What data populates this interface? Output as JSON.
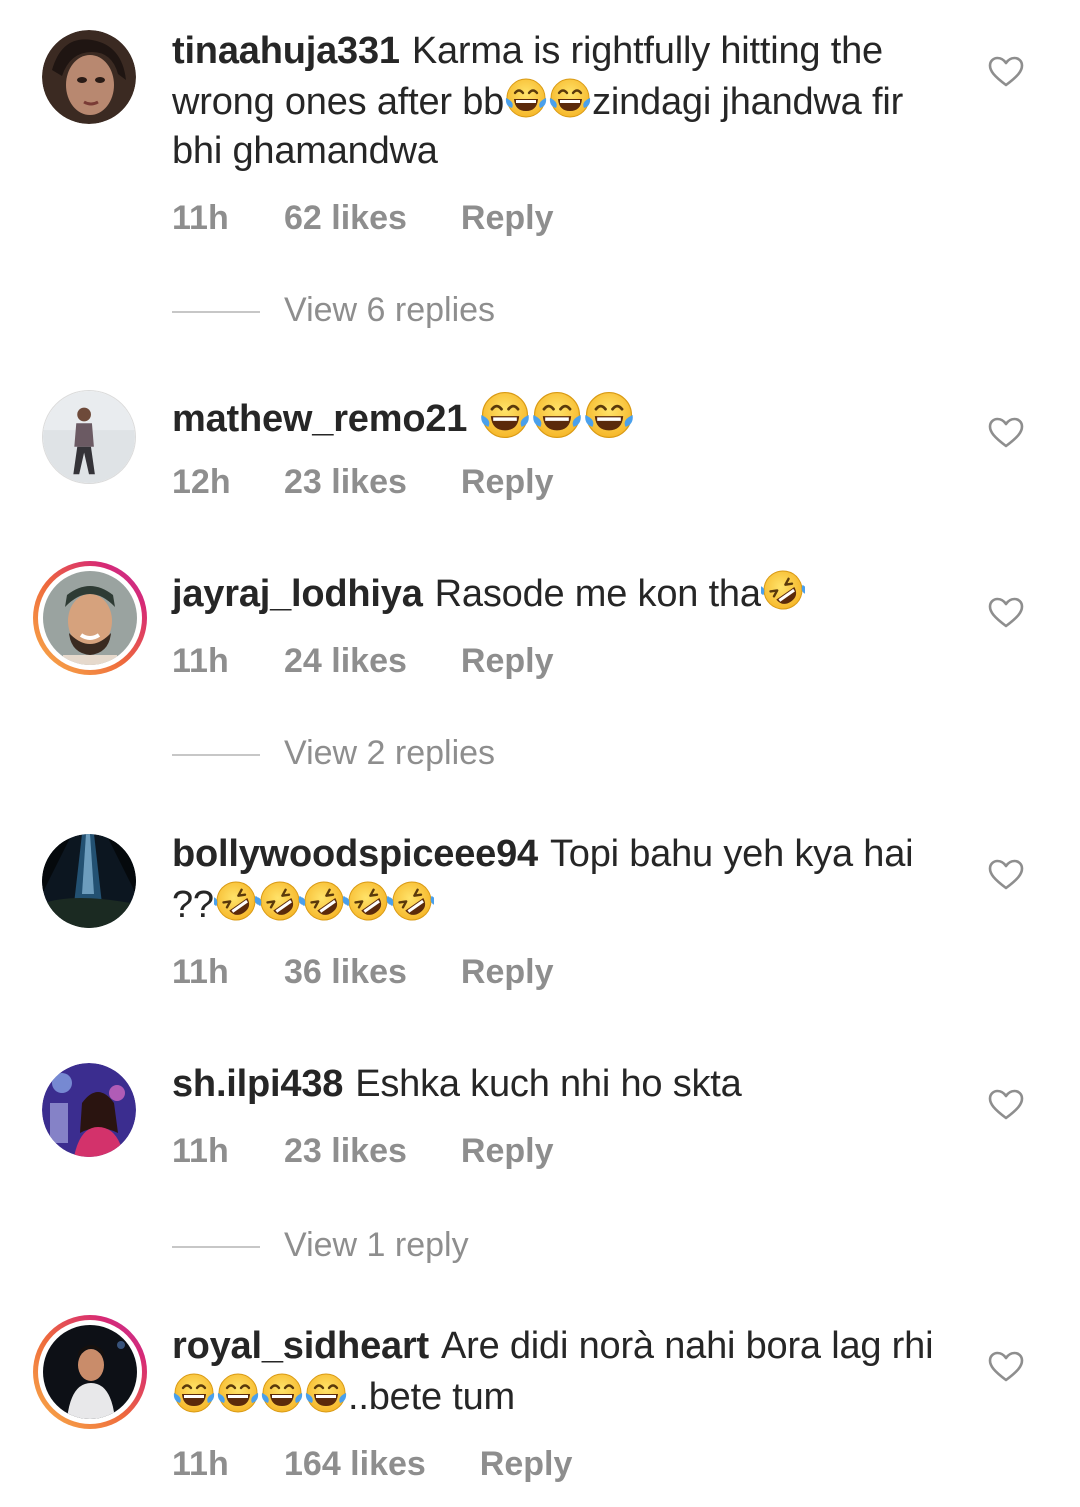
{
  "comments": [
    {
      "username": "tinaahuja331",
      "text_parts": [
        "Karma is rightfully hitting the wrong ones after bb",
        "zindagi jhandwa fir bhi ghamandwa"
      ],
      "emojis": [
        "face-with-tears-of-joy",
        "face-with-tears-of-joy"
      ],
      "time": "11h",
      "likes": "62 likes",
      "reply": "Reply",
      "view_replies": "View 6 replies"
    },
    {
      "username": "mathew_remo21",
      "text_parts": [
        ""
      ],
      "emojis": [
        "face-with-tears-of-joy",
        "face-with-tears-of-joy",
        "face-with-tears-of-joy"
      ],
      "time": "12h",
      "likes": "23 likes",
      "reply": "Reply"
    },
    {
      "username": "jayraj_lodhiya",
      "text_parts": [
        "Rasode me kon tha"
      ],
      "emojis": [
        "rolling-on-the-floor-laughing"
      ],
      "time": "11h",
      "likes": "24 likes",
      "reply": "Reply",
      "view_replies": "View 2 replies"
    },
    {
      "username": "bollywoodspiceee94",
      "text_parts": [
        "Topi bahu yeh kya hai ??"
      ],
      "emojis": [
        "rolling-on-the-floor-laughing",
        "rolling-on-the-floor-laughing",
        "rolling-on-the-floor-laughing",
        "rolling-on-the-floor-laughing",
        "rolling-on-the-floor-laughing"
      ],
      "time": "11h",
      "likes": "36 likes",
      "reply": "Reply"
    },
    {
      "username": "sh.ilpi438",
      "text_parts": [
        "Eshka kuch nhi ho skta"
      ],
      "emojis": [],
      "time": "11h",
      "likes": "23 likes",
      "reply": "Reply",
      "view_replies": "View 1 reply"
    },
    {
      "username": "royal_sidheart",
      "text_parts": [
        "Are didi norà nahi bora lag rhi",
        "..bete tum"
      ],
      "emojis": [
        "face-with-tears-of-joy",
        "face-with-tears-of-joy",
        "face-with-tears-of-joy",
        "face-with-tears-of-joy"
      ],
      "time": "11h",
      "likes": "164 likes",
      "reply": "Reply"
    }
  ],
  "icons": {
    "like": "heart-outline-icon"
  },
  "colors": {
    "text": "#262626",
    "meta": "#8e8e8e",
    "divider": "#c7c7c7"
  }
}
